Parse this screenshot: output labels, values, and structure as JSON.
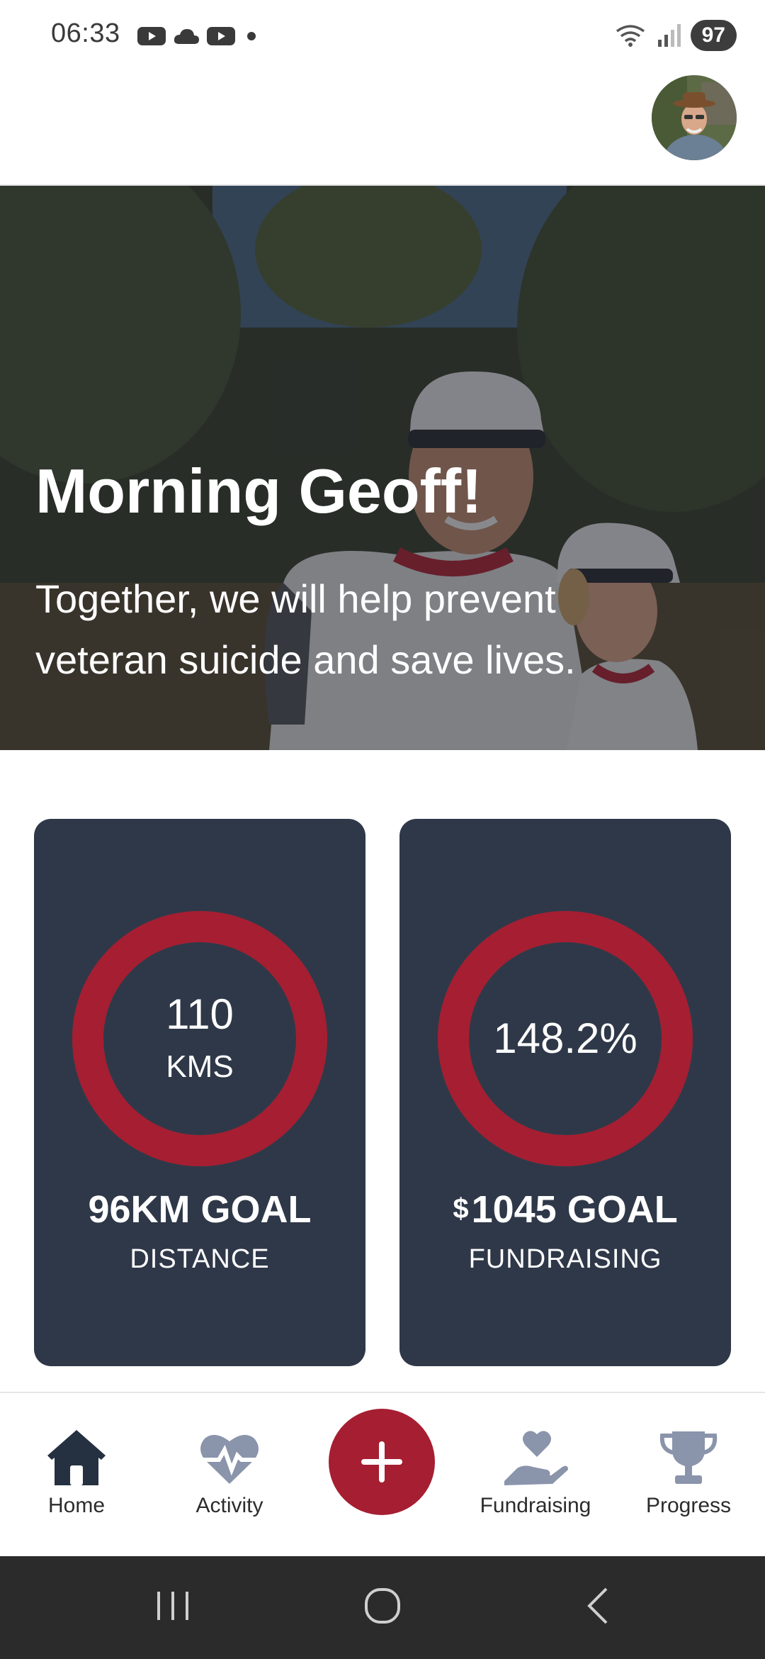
{
  "status_bar": {
    "time": "06:33",
    "battery": "97",
    "left_icons": [
      "youtube-icon",
      "cloud-icon",
      "youtube-icon",
      "dot-icon"
    ],
    "right_icons": [
      "wifi-icon",
      "signal-icon",
      "battery-icon"
    ]
  },
  "header": {
    "avatar": "profile-avatar"
  },
  "hero": {
    "title": "Morning Geoff!",
    "subtitle": "Together, we will help prevent veteran suicide and save lives."
  },
  "stats": {
    "distance": {
      "value": "110",
      "unit": "KMS",
      "goal": "96KM GOAL",
      "label": "DISTANCE",
      "progress": 1.0
    },
    "fundraising": {
      "value": "148.2%",
      "currency": "$",
      "goal": "1045 GOAL",
      "label": "FUNDRAISING",
      "progress": 1.0
    }
  },
  "bottom_nav": {
    "items": [
      {
        "label": "Home",
        "icon": "home-icon"
      },
      {
        "label": "Activity",
        "icon": "heart-pulse-icon"
      },
      {
        "label": "",
        "icon": "plus-icon"
      },
      {
        "label": "Fundraising",
        "icon": "hand-heart-icon"
      },
      {
        "label": "Progress",
        "icon": "trophy-icon"
      }
    ]
  },
  "colors": {
    "accent": "#a61e31",
    "card_bg": "#2f3848",
    "nav_icon": "#8a94ab",
    "home_icon": "#253040"
  }
}
